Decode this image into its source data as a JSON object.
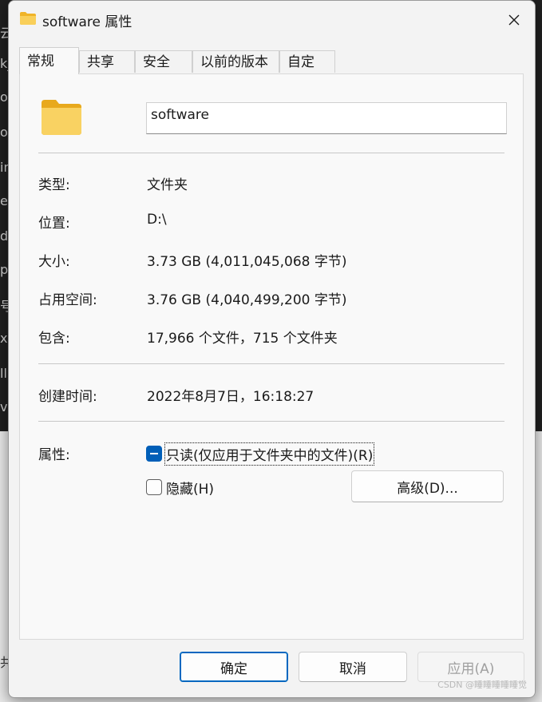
{
  "window": {
    "title": "software 属性",
    "close_glyph": "✕"
  },
  "background_glyphs": [
    "云",
    "k_",
    "o.",
    "o.",
    "in",
    "e",
    "d:",
    "p",
    "号",
    "x",
    "ll",
    "va",
    "共"
  ],
  "tabs": [
    {
      "label": "常规",
      "active": true
    },
    {
      "label": "共享",
      "active": false
    },
    {
      "label": "安全",
      "active": false
    },
    {
      "label": "以前的版本",
      "active": false
    },
    {
      "label": "自定义",
      "active": false
    }
  ],
  "general": {
    "folder_name": "software",
    "fields": [
      {
        "label": "类型:",
        "value": "文件夹"
      },
      {
        "label": "位置:",
        "value": "D:\\"
      },
      {
        "label": "大小:",
        "value": "3.73 GB (4,011,045,068 字节)"
      },
      {
        "label": "占用空间:",
        "value": "3.76 GB (4,040,499,200 字节)"
      },
      {
        "label": "包含:",
        "value": "17,966 个文件，715 个文件夹"
      }
    ],
    "created": {
      "label": "创建时间:",
      "value": "2022年8月7日，16:18:27"
    },
    "attributes": {
      "label": "属性:",
      "readonly_label": "只读(仅应用于文件夹中的文件)(R)",
      "readonly_state": "indeterminate",
      "hidden_label": "隐藏(H)",
      "hidden_state": "unchecked",
      "advanced_label": "高级(D)..."
    }
  },
  "footer": {
    "ok_label": "确定",
    "cancel_label": "取消",
    "apply_label": "应用(A)"
  },
  "watermark": "CSDN @睡睡睡睡睡觉",
  "colors": {
    "accent": "#005fb8",
    "folder": "#f6c545"
  }
}
